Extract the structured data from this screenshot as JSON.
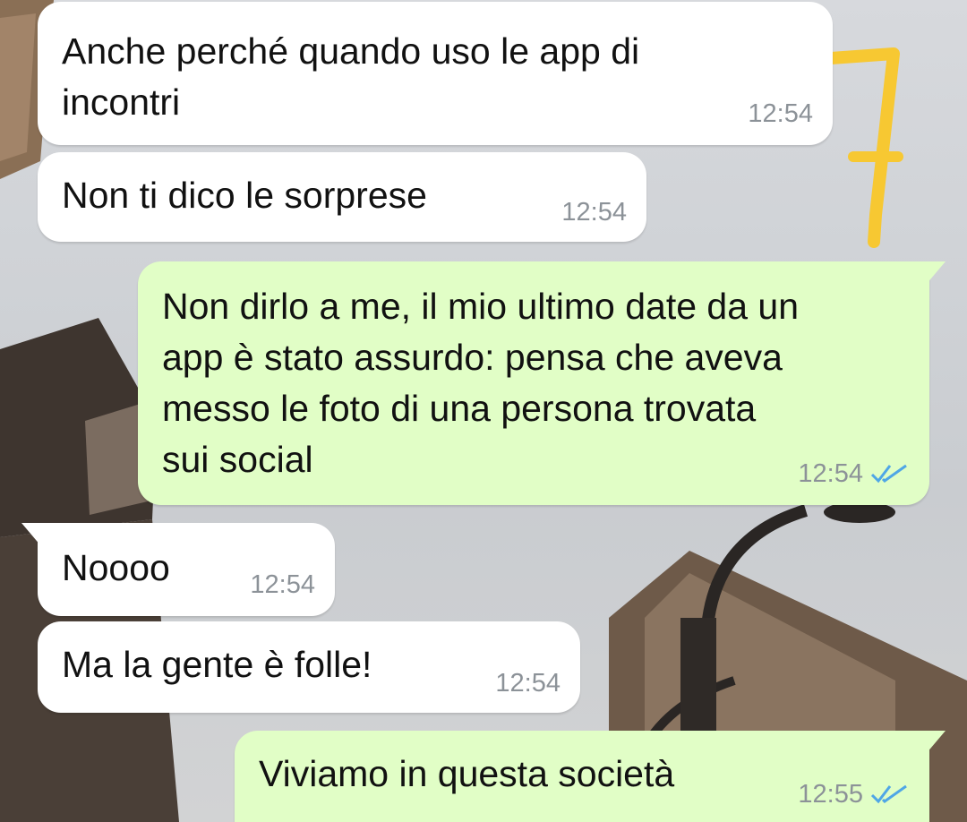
{
  "messages": [
    {
      "direction": "incoming",
      "text_line1": "Anche perché quando uso le app di",
      "text_line2": "incontri",
      "time": "12:54"
    },
    {
      "direction": "incoming",
      "text": "Non ti dico le sorprese",
      "time": "12:54"
    },
    {
      "direction": "outgoing",
      "text_lines": [
        "Non dirlo a me, il mio ultimo date da un",
        "app è stato assurdo: pensa che aveva",
        "messo le foto di una persona trovata",
        "sui social"
      ],
      "time": "12:54",
      "status": "read"
    },
    {
      "direction": "incoming",
      "text": "Noooo",
      "time": "12:54"
    },
    {
      "direction": "incoming",
      "text": "Ma la gente è folle!",
      "time": "12:54"
    },
    {
      "direction": "outgoing",
      "text": "Viviamo in questa società",
      "time": "12:55",
      "status": "read"
    }
  ],
  "annotation": {
    "glyph": "7",
    "color": "#f7c832"
  },
  "colors": {
    "incoming_bubble": "#ffffff",
    "outgoing_bubble": "#e1fec6",
    "tick_blue": "#4fa6e6",
    "time_gray": "#8c9298"
  },
  "icons": {
    "read_receipt": "double-check-icon"
  }
}
